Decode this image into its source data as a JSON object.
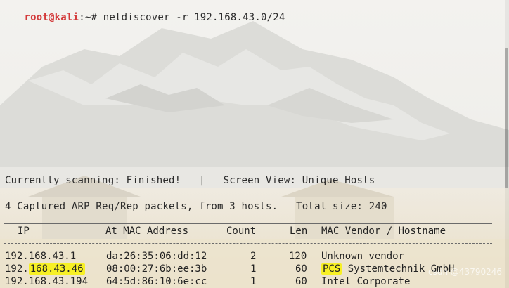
{
  "prompt": {
    "user_host": "root@kali",
    "path_sep": ":~# ",
    "command": "netdiscover -r 192.168.43.0/24"
  },
  "status": {
    "scanning": "Currently scanning: Finished!   |   Screen View: Unique Hosts",
    "captured": "4 Captured ARP Req/Rep packets, from 3 hosts.   Total size: 240"
  },
  "table": {
    "headers": {
      "ip": "IP",
      "mac": "At MAC Address",
      "count": "Count",
      "len": "Len",
      "vendor": "MAC Vendor / Hostname"
    },
    "rows": [
      {
        "ip": "192.168.43.1",
        "mac": "da:26:35:06:dd:12",
        "count": "2",
        "len": "120",
        "vendor": "Unknown vendor"
      },
      {
        "ip_prefix": "192.",
        "ip_highlight": "168.43.46",
        "mac": "08:00:27:6b:ee:3b",
        "count": "1",
        "len": "60",
        "vendor_highlight": "PCS",
        "vendor_rest": " Systemtechnik GmbH"
      },
      {
        "ip": "192.168.43.194",
        "mac": "64:5d:86:10:6e:cc",
        "count": "1",
        "len": "60",
        "vendor": "Intel Corporate"
      }
    ]
  },
  "watermark": "csdn @43790246",
  "colors": {
    "highlight": "#f7f025",
    "prompt": "#d33a3a"
  }
}
